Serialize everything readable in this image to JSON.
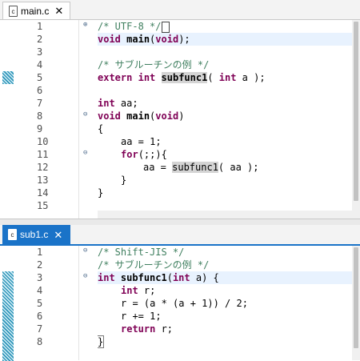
{
  "editor1": {
    "tab_label": "main.c",
    "file_icon_text": "c",
    "line_numbers": [
      "1",
      "2",
      "3",
      "4",
      "5",
      "6",
      "7",
      "8",
      "9",
      "10",
      "11",
      "12",
      "13",
      "14",
      "15"
    ],
    "lines": {
      "l1_comment": "/* UTF-8 */",
      "l2_kw": "void",
      "l2_fn": "main",
      "l2_kw2": "void",
      "l2_rest": ");",
      "l4_comment": "/* サブルーチンの例 */",
      "l6_kw1": "extern",
      "l6_kw2": "int",
      "l6_fn": "subfunc1",
      "l6_mid": "( ",
      "l6_kw3": "int",
      "l6_rest": " a );",
      "l8_kw": "int",
      "l8_rest": " aa;",
      "l9_kw": "void",
      "l9_fn": "main",
      "l9_kw2": "void",
      "l9_rest": ")",
      "l10": "{",
      "l11": "aa = 1;",
      "l12_kw": "for",
      "l12_rest": "(;;){",
      "l13_pre": "aa = ",
      "l13_fn": "subfunc1",
      "l13_rest": "( aa );",
      "l14": "}",
      "l15": "}"
    }
  },
  "editor2": {
    "tab_label": "sub1.c",
    "file_icon_text": "c",
    "line_numbers": [
      "1",
      "2",
      "3",
      "4",
      "5",
      "6",
      "7",
      "8"
    ],
    "lines": {
      "l1_comment": "/* Shift-JIS */",
      "l2_comment": "/* サブルーチンの例 */",
      "l3_kw": "int",
      "l3_fn": "subfunc1",
      "l3_kw2": "int",
      "l3_rest": " a) {",
      "l4_kw": "int",
      "l4_rest": " r;",
      "l5": "r = (a * (a + 1)) / 2;",
      "l6": "r += 1;",
      "l7_kw": "return",
      "l7_rest": " r;",
      "l8": "}"
    }
  },
  "colors": {
    "keyword": "#7f0055",
    "comment": "#3f7f5f",
    "active_tab": "#1a73c8",
    "current_line": "#e8f2fe"
  },
  "icons": {
    "close": "close-icon",
    "fold_expanded": "fold-collapse-icon",
    "fold_collapsed": "fold-expand-icon",
    "file": "c-file-icon"
  }
}
